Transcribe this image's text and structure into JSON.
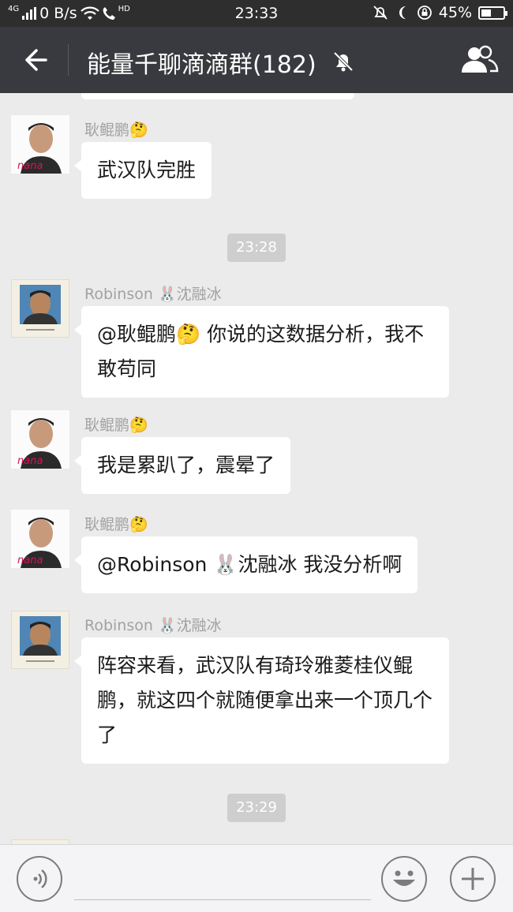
{
  "status_bar": {
    "network_type": "4G",
    "net_speed": "0 B/s",
    "call_badge": "HD",
    "time": "23:33",
    "battery": "45%",
    "battery_level": 0.45
  },
  "header": {
    "title": "能量千聊滴滴群(182)"
  },
  "messages": [
    {
      "sender": "耿鲲鹏🤔",
      "text": "武汉队完胜"
    },
    {
      "sender": "Robinson 🐰沈融冰",
      "text": "@耿鲲鹏🤔 你说的这数据分析，我不敢苟同"
    },
    {
      "sender": "耿鲲鹏🤔",
      "text": "我是累趴了，震晕了"
    },
    {
      "sender": "耿鲲鹏🤔",
      "text": "@Robinson 🐰沈融冰 我没分析啊"
    },
    {
      "sender": "Robinson 🐰沈融冰",
      "text": "阵容来看，武汉队有琦玲雅菱桂仪鲲鹏，就这四个就随便拿出来一个顶几个了"
    }
  ],
  "timestamps": [
    "23:28",
    "23:29"
  ],
  "colors": {
    "navbar": "#393a3f",
    "statusbar": "#2e2e2e",
    "chat_bg": "#ebebeb",
    "bubble": "#ffffff",
    "time_pill": "#cecece"
  },
  "icons": {
    "back": "arrow-left-icon",
    "mute": "bell-off-icon",
    "members": "group-icon",
    "voice": "voice-icon",
    "emoji": "smiley-icon",
    "plus": "plus-icon"
  }
}
